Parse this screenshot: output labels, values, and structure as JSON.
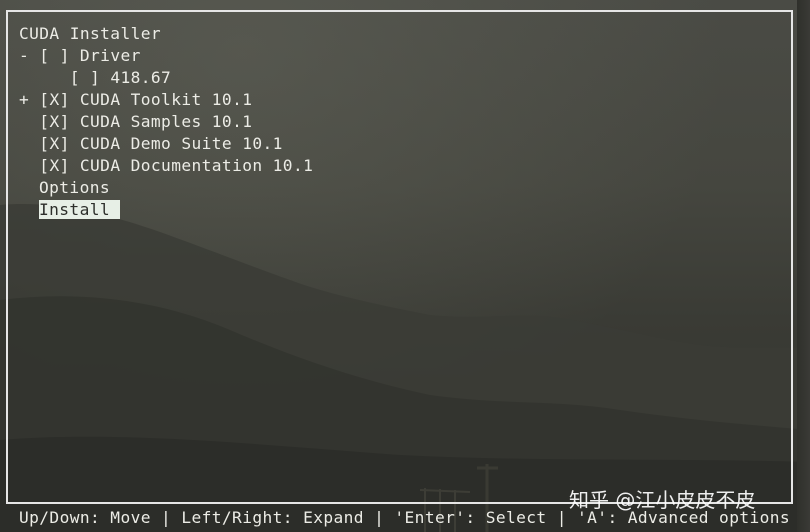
{
  "installer": {
    "title": "CUDA Installer",
    "items": [
      {
        "prefix": "- ",
        "checkbox": "[ ]",
        "label": "Driver"
      },
      {
        "prefix": "     ",
        "checkbox": "[ ]",
        "label": "418.67"
      },
      {
        "prefix": "+ ",
        "checkbox": "[X]",
        "label": "CUDA Toolkit 10.1"
      },
      {
        "prefix": "  ",
        "checkbox": "[X]",
        "label": "CUDA Samples 10.1"
      },
      {
        "prefix": "  ",
        "checkbox": "[X]",
        "label": "CUDA Demo Suite 10.1"
      },
      {
        "prefix": "  ",
        "checkbox": "[X]",
        "label": "CUDA Documentation 10.1"
      }
    ],
    "options_label": "Options",
    "install_label": "Install"
  },
  "status_bar": {
    "text": "Up/Down: Move | Left/Right: Expand | 'Enter': Select | 'A': Advanced options"
  },
  "watermark": {
    "text": "知乎 @江小皮皮不皮"
  },
  "colors": {
    "terminal_text": "#ecece6",
    "highlight_bg": "#e7efe6",
    "border": "#e6e6e6"
  }
}
